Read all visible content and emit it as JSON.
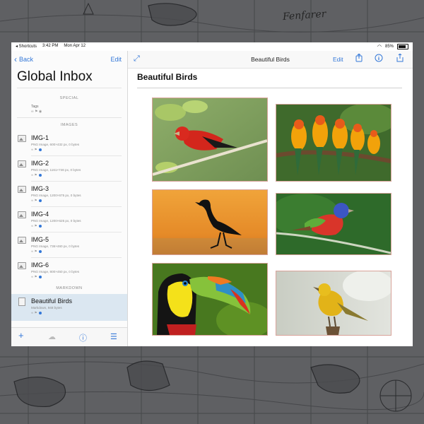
{
  "status_bar": {
    "app": "◂ Shortcuts",
    "time": "3:42 PM",
    "date": "Mon Apr 12",
    "battery": "85%"
  },
  "decor": {
    "map_script": "Fenfarer"
  },
  "sidebar": {
    "back_label": "Back",
    "edit_label": "Edit",
    "title": "Global Inbox",
    "sections": {
      "special": "SPECIAL",
      "images": "IMAGES",
      "markdown": "MARKDOWN"
    },
    "tags_label": "Tags",
    "tags_marks": "∞ ⚑ ◉",
    "images": [
      {
        "name": "IMG-1",
        "meta": "PNG Image, 600×432 px, 0 bytes"
      },
      {
        "name": "IMG-2",
        "meta": "PNG Image, 1161×746 px, 0 bytes"
      },
      {
        "name": "IMG-3",
        "meta": "PNG Image, 1200×675 px, 0 bytes"
      },
      {
        "name": "IMG-4",
        "meta": "PNG Image, 1200×625 px, 0 bytes"
      },
      {
        "name": "IMG-5",
        "meta": "PNG Image, 736×460 px, 0 bytes"
      },
      {
        "name": "IMG-6",
        "meta": "PNG Image, 800×450 px, 0 bytes"
      }
    ],
    "item_marks": "∞ ⚑",
    "markdown_item": {
      "name": "Beautiful Birds",
      "meta": "Markdown, 948 bytes"
    },
    "toolbar": {
      "add": "+",
      "cloud": "☁",
      "info": "ⓘ",
      "list": "☰"
    }
  },
  "content": {
    "nav_title": "Beautiful Birds",
    "edit_label": "Edit",
    "heading": "Beautiful Birds",
    "icons": {
      "expand": "expand-icon",
      "share": "share-icon",
      "info": "info-icon",
      "export": "export-icon"
    }
  },
  "colors": {
    "accent": "#3478d8",
    "selection": "#dbe7f1",
    "photo_border": "#d8a39a"
  }
}
